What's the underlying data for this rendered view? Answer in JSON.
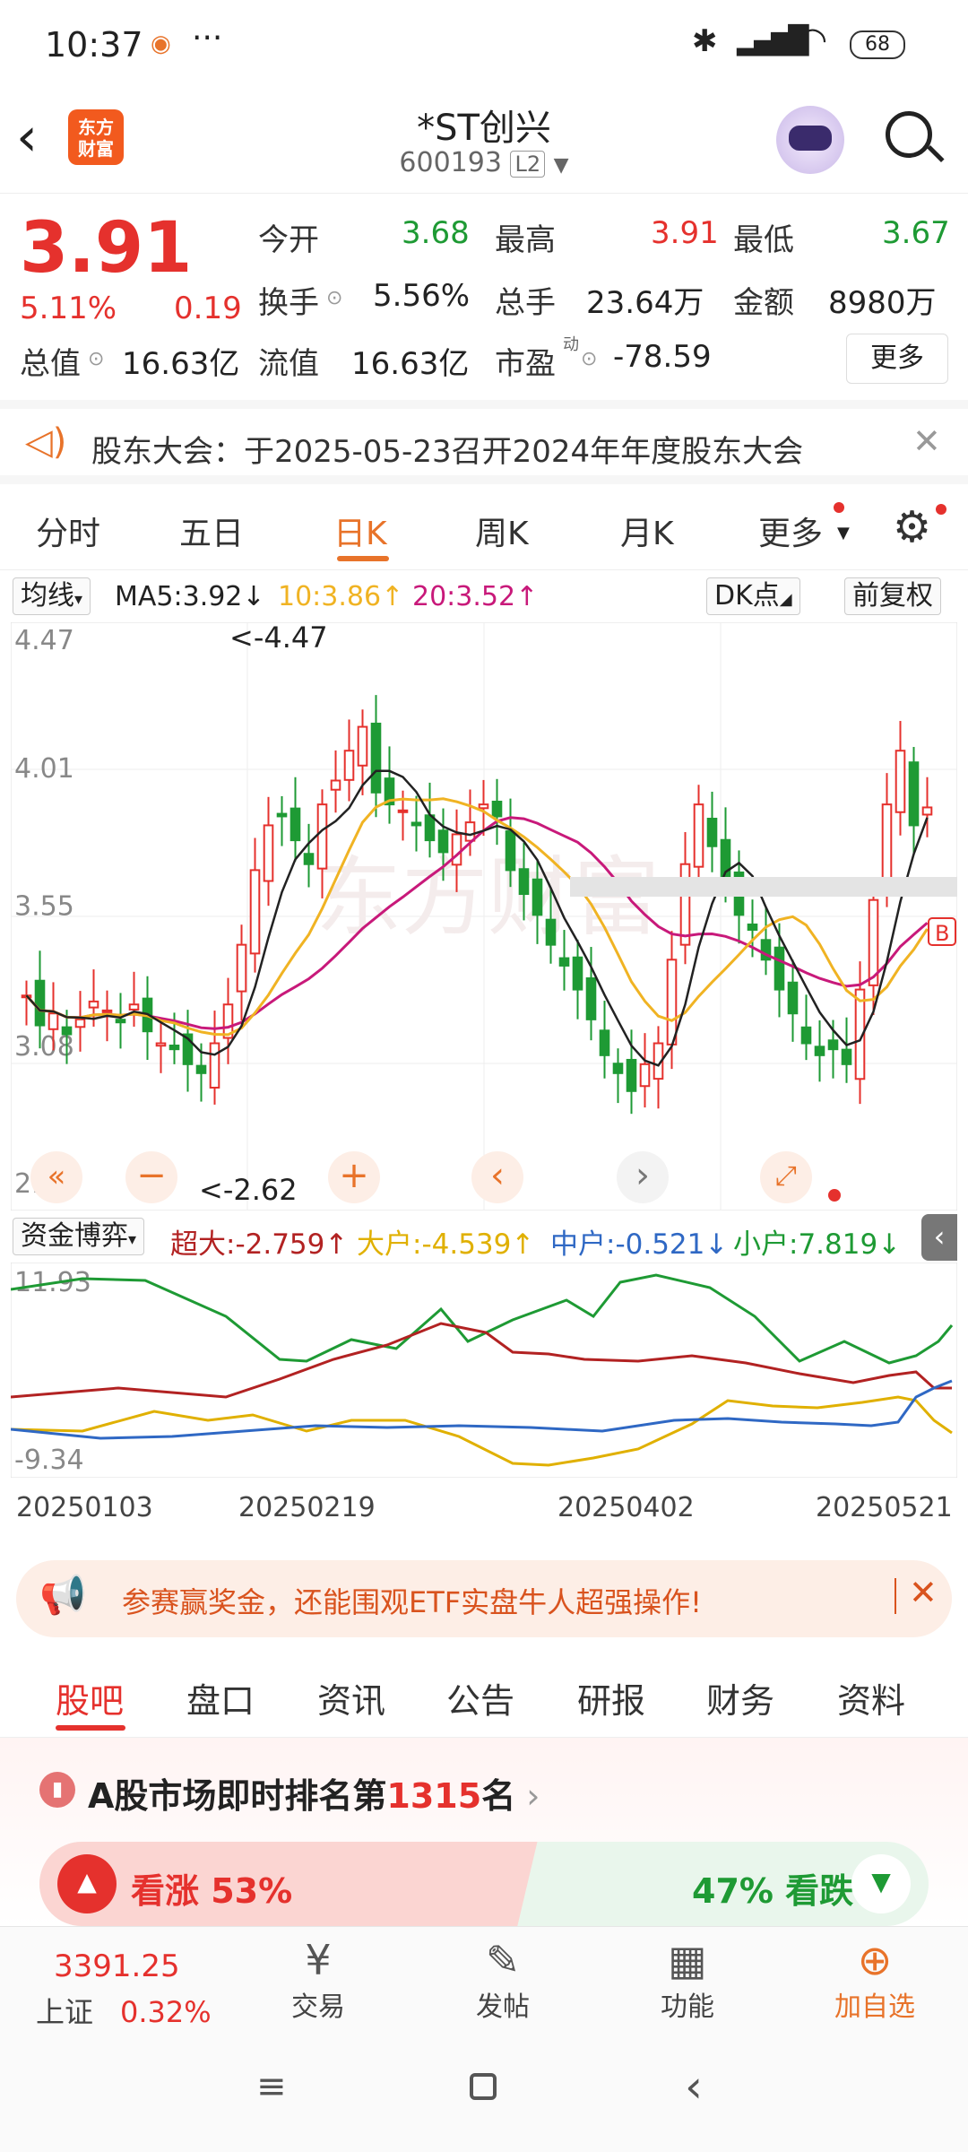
{
  "status": {
    "time": "10:37",
    "battery": "68",
    "dots": "···"
  },
  "header": {
    "title": "*ST创兴",
    "code": "600193",
    "level": "L2",
    "logo_line1": "东方",
    "logo_line2": "财富"
  },
  "quote": {
    "price": "3.91",
    "change_pct": "5.11%",
    "change": "0.19",
    "open_label": "今开",
    "open": "3.68",
    "high_label": "最高",
    "high": "3.91",
    "low_label": "最低",
    "low": "3.67",
    "turnover_label": "换手",
    "turnover": "5.56%",
    "volume_label": "总手",
    "volume": "23.64万",
    "amount_label": "金额",
    "amount": "8980万",
    "mcap_label": "总值",
    "mcap": "16.63亿",
    "float_label": "流值",
    "float": "16.63亿",
    "pe_label": "市盈",
    "pe_sup": "动",
    "pe": "-78.59",
    "more_label": "更多"
  },
  "notice": {
    "text": "股东大会：于2025-05-23召开2024年年度股东大会"
  },
  "chart_tabs": [
    "分时",
    "五日",
    "日K",
    "周K",
    "月K",
    "更多"
  ],
  "toolbar": {
    "ma_select": "均线",
    "ma5": "MA5:3.92↓",
    "ma10": "10:3.86↑",
    "ma20": "20:3.52↑",
    "dk": "DK点",
    "adjust": "前复权"
  },
  "kchart": {
    "y_ticks": [
      "4.47",
      "4.01",
      "3.55",
      "3.08",
      "2.62"
    ],
    "high_mark": "<-4.47",
    "low_mark": "<-2.62",
    "watermark": "东方财富",
    "b_mark": "B"
  },
  "capital": {
    "select": "资金博弈",
    "super": "超大:-2.759↑",
    "big": "大户:-4.539↑",
    "mid": "中户:-0.521↓",
    "small": "小户:7.819↓",
    "y_top": "11.93",
    "y_bottom": "-9.34"
  },
  "dates": [
    "20250103",
    "20250219",
    "20250402",
    "20250521"
  ],
  "promo": {
    "text": "参赛赢奖金，还能围观ETF实盘牛人超强操作!"
  },
  "subtabs": [
    "股吧",
    "盘口",
    "资讯",
    "公告",
    "研报",
    "财务",
    "资料"
  ],
  "rank": {
    "prefix": "A股市场即时排名第",
    "number": "1315",
    "suffix": "名",
    "up_label": "看涨 53%",
    "down_label": "47% 看跌"
  },
  "bottom": {
    "index_value": "3391.25",
    "index_name": "上证",
    "index_change": "0.32%",
    "trade": "交易",
    "post": "发帖",
    "func": "功能",
    "add": "加自选"
  },
  "colors": {
    "red": "#e5312d",
    "green": "#1e9a34",
    "ma5": "#222222",
    "ma10": "#f0b323",
    "ma20": "#c8197a",
    "mid": "#2f68c4"
  }
}
